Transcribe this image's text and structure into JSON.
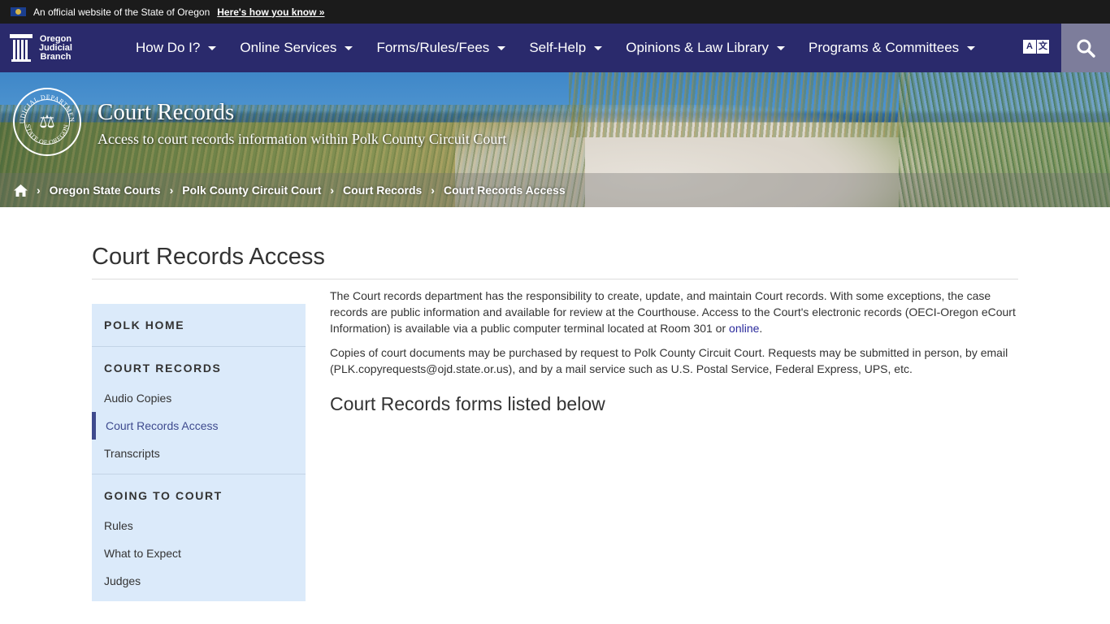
{
  "gov_banner": {
    "text": "An official website of the State of Oregon",
    "link": "Here's how you know »"
  },
  "brand": {
    "line1": "Oregon",
    "line2": "Judicial",
    "line3": "Branch"
  },
  "nav": {
    "items": [
      {
        "label": "How Do I?"
      },
      {
        "label": "Online Services"
      },
      {
        "label": "Forms/Rules/Fees"
      },
      {
        "label": "Self-Help"
      },
      {
        "label": "Opinions & Law Library"
      },
      {
        "label": "Programs & Committees"
      }
    ],
    "translate_a": "A",
    "translate_b": "文"
  },
  "hero": {
    "title": "Court Records",
    "subtitle": "Access to court records information within Polk County Circuit Court",
    "seal_top": "JUDICIAL DEPARTMENT",
    "seal_bottom": "STATE OF OREGON"
  },
  "breadcrumb": {
    "items": [
      {
        "label": "Oregon State Courts"
      },
      {
        "label": "Polk County Circuit Court"
      },
      {
        "label": "Court Records"
      },
      {
        "label": "Court Records Access"
      }
    ]
  },
  "page": {
    "title": "Court Records Access"
  },
  "sidenav": {
    "sections": [
      {
        "heading": "POLK HOME",
        "items": []
      },
      {
        "heading": "COURT RECORDS",
        "items": [
          {
            "label": "Audio Copies"
          },
          {
            "label": "Court Records Access",
            "active": true
          },
          {
            "label": "Transcripts"
          }
        ]
      },
      {
        "heading": "GOING TO COURT",
        "items": [
          {
            "label": "Rules"
          },
          {
            "label": "What to Expect"
          },
          {
            "label": "Judges"
          }
        ]
      }
    ]
  },
  "content": {
    "p1_text": "The Court records department has the responsibility to create, update, and maintain Court records. With some exceptions, the case records are public information and available for review at the Courthouse. Access to the Court's electronic records (OECI-Oregon eCourt Information) is available via a public computer terminal located at Room 301 or ",
    "p1_link": "online",
    "p1_end": ".",
    "p2_text": "Copies of court documents may be purchased by request to Polk County Circuit Court. Requests may be submitted in person, by email (PLK.copyrequests@ojd.state.or.us), and by a mail service such as U.S. Postal Service, Federal Express, UPS, etc.",
    "subheading": "Court Records forms listed below"
  },
  "colors": {
    "nav_bg": "#2a2a6c",
    "banner_bg": "#1b1b1b",
    "sidenav_bg": "#dbeafa",
    "active_accent": "#3e4a8e",
    "search_bg": "#7d7d9b",
    "link": "#2a2a9c"
  }
}
